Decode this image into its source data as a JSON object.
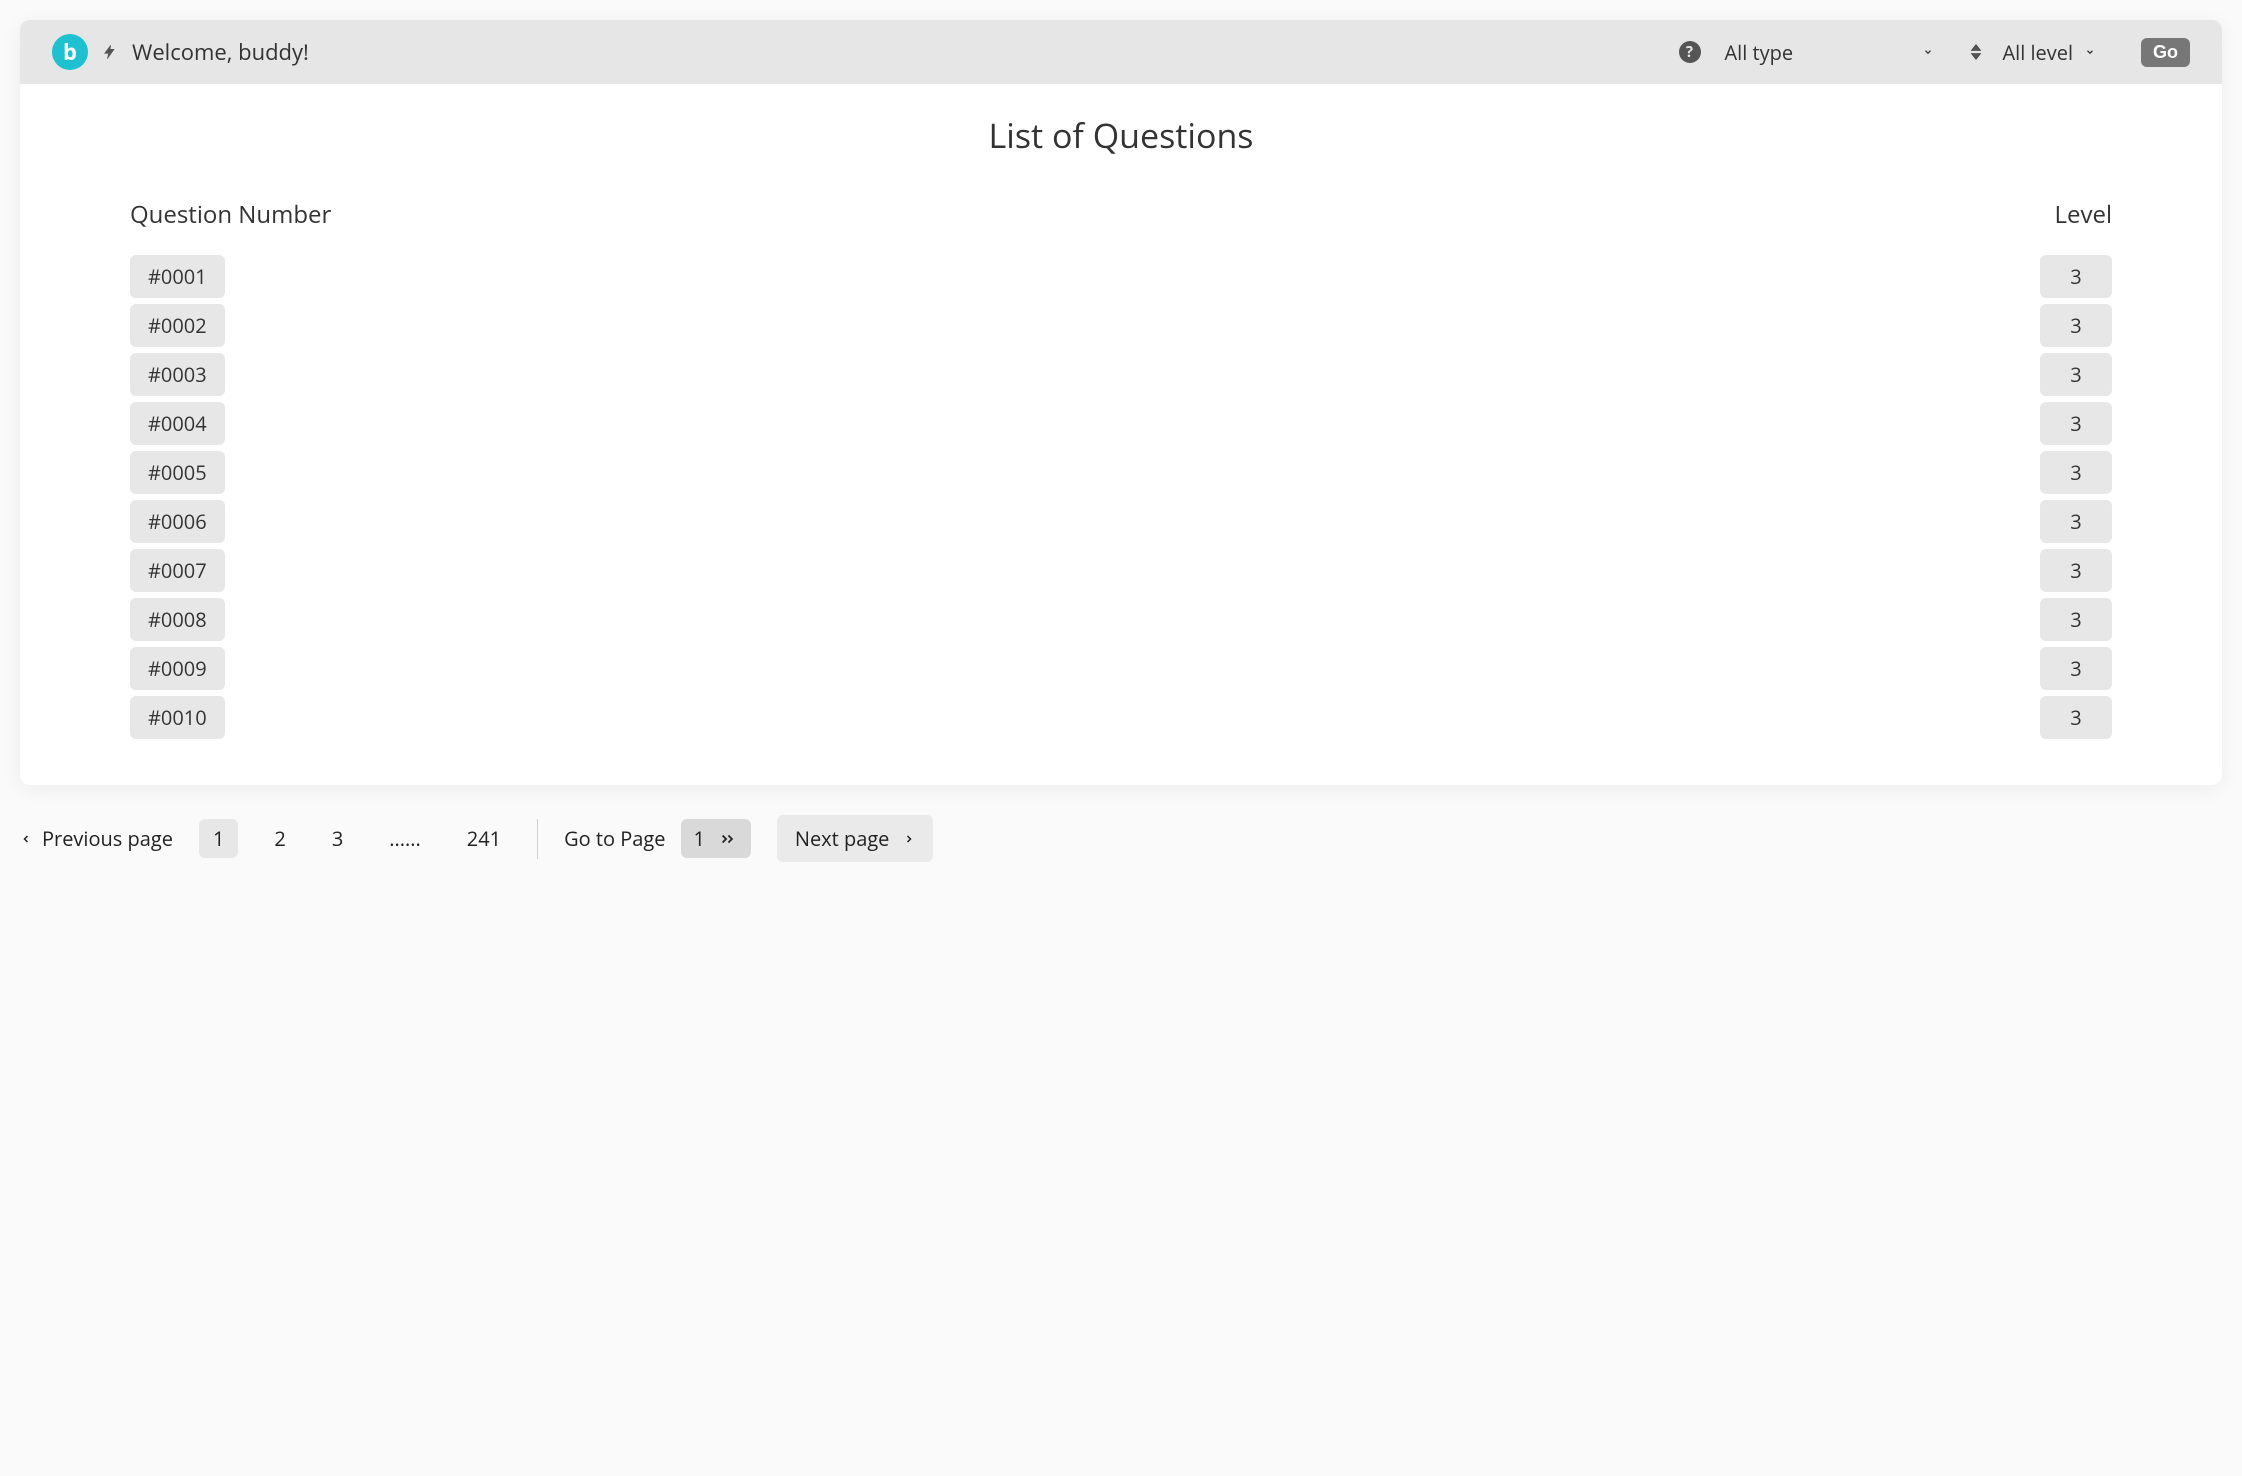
{
  "header": {
    "logo_letter": "b",
    "welcome": "Welcome, buddy!",
    "type_filter": "All type",
    "level_filter": "All level",
    "go_label": "Go"
  },
  "main": {
    "title": "List of Questions",
    "col_question": "Question Number",
    "col_level": "Level",
    "rows": [
      {
        "num": "#0001",
        "level": "3"
      },
      {
        "num": "#0002",
        "level": "3"
      },
      {
        "num": "#0003",
        "level": "3"
      },
      {
        "num": "#0004",
        "level": "3"
      },
      {
        "num": "#0005",
        "level": "3"
      },
      {
        "num": "#0006",
        "level": "3"
      },
      {
        "num": "#0007",
        "level": "3"
      },
      {
        "num": "#0008",
        "level": "3"
      },
      {
        "num": "#0009",
        "level": "3"
      },
      {
        "num": "#0010",
        "level": "3"
      }
    ]
  },
  "pager": {
    "prev": "Previous page",
    "pages": [
      "1",
      "2",
      "3"
    ],
    "ellipsis": "......",
    "last": "241",
    "goto_label": "Go to Page",
    "goto_value": "1",
    "next": "Next page"
  }
}
